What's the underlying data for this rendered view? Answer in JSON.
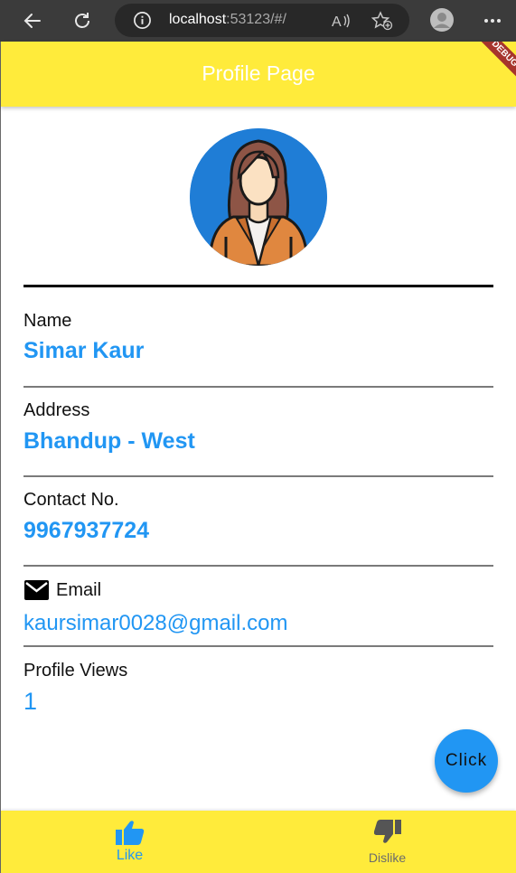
{
  "browser": {
    "url_host": "localhost",
    "url_rest": ":53123/#/"
  },
  "app_bar": {
    "title": "Profile Page",
    "debug_label": "DEBUG",
    "color": "#ffeb3b"
  },
  "profile": {
    "fields": [
      {
        "label": "Name",
        "value": "Simar Kaur"
      },
      {
        "label": "Address",
        "value": "Bhandup - West"
      },
      {
        "label": "Contact No.",
        "value": "9967937724"
      },
      {
        "label": "Email",
        "value": "kaursimar0028@gmail.com",
        "icon": "mail-icon"
      },
      {
        "label": "Profile Views",
        "value": "1"
      }
    ],
    "avatar_icon": "woman-avatar-icon",
    "accent": "#2196f3"
  },
  "fab": {
    "label": "Click"
  },
  "bottom_nav": {
    "items": [
      {
        "label": "Like",
        "icon": "thumb-up-icon",
        "selected": true
      },
      {
        "label": "Dislike",
        "icon": "thumb-down-icon",
        "selected": false
      }
    ]
  }
}
